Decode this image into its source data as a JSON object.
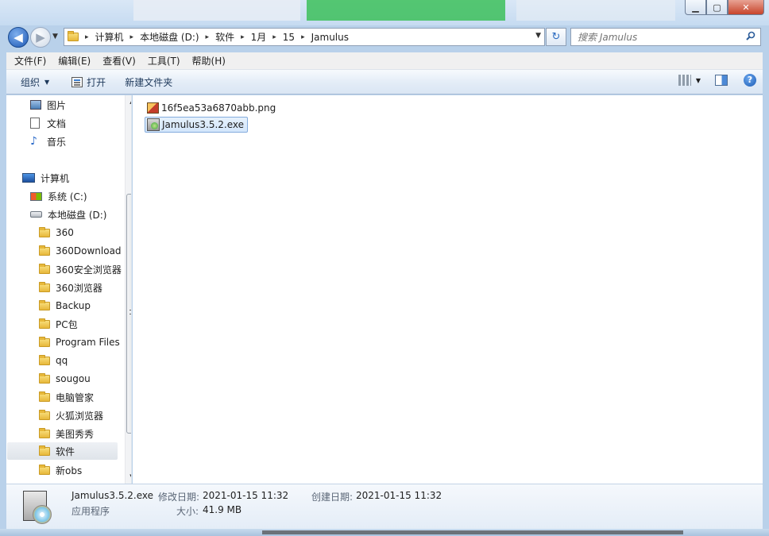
{
  "window": {
    "controls": {
      "minimize": "▁",
      "maximize": "▢",
      "close": "✕"
    }
  },
  "navigation": {
    "back_glyph": "◀",
    "forward_glyph": "▶",
    "history_glyph": "▼"
  },
  "address": {
    "breadcrumbs": [
      "计算机",
      "本地磁盘 (D:)",
      "软件",
      "1月",
      "15",
      "Jamulus"
    ],
    "separator": "▸",
    "dropdown_glyph": "▼",
    "refresh_glyph": "↻"
  },
  "search": {
    "placeholder": "搜索 Jamulus"
  },
  "menubar": {
    "items": [
      "文件(F)",
      "编辑(E)",
      "查看(V)",
      "工具(T)",
      "帮助(H)"
    ]
  },
  "commandbar": {
    "organize": "组织",
    "organize_arrow": "▼",
    "open": "打开",
    "new_folder": "新建文件夹",
    "view_arrow": "▼",
    "help_glyph": "?"
  },
  "nav_pane": {
    "items": [
      {
        "label": "图片",
        "icon": "pictures-icon"
      },
      {
        "label": "文档",
        "icon": "documents-icon"
      },
      {
        "label": "音乐",
        "icon": "music-icon"
      },
      {
        "label": "计算机",
        "icon": "computer-icon"
      },
      {
        "label": "系统 (C:)",
        "icon": "system-drive-icon"
      },
      {
        "label": "本地磁盘 (D:)",
        "icon": "drive-icon"
      },
      {
        "label": "360",
        "icon": "folder-icon"
      },
      {
        "label": "360Download",
        "icon": "folder-icon"
      },
      {
        "label": "360安全浏览器",
        "icon": "folder-icon"
      },
      {
        "label": "360浏览器",
        "icon": "folder-icon"
      },
      {
        "label": "Backup",
        "icon": "folder-icon"
      },
      {
        "label": "PC包",
        "icon": "folder-icon"
      },
      {
        "label": "Program Files",
        "icon": "folder-icon"
      },
      {
        "label": "qq",
        "icon": "folder-icon"
      },
      {
        "label": "sougou",
        "icon": "folder-icon"
      },
      {
        "label": "电脑管家",
        "icon": "folder-icon"
      },
      {
        "label": "火狐浏览器",
        "icon": "folder-icon"
      },
      {
        "label": "美图秀秀",
        "icon": "folder-icon"
      },
      {
        "label": "软件",
        "icon": "folder-icon",
        "selected": true
      },
      {
        "label": "新obs",
        "icon": "folder-icon"
      }
    ],
    "scroll_up": "▲",
    "scroll_down": "▼"
  },
  "files": [
    {
      "name": "16f5ea53a6870abb.png",
      "icon": "png-file-icon",
      "selected": false
    },
    {
      "name": "Jamulus3.5.2.exe",
      "icon": "exe-file-icon",
      "selected": true
    }
  ],
  "details": {
    "filename": "Jamulus3.5.2.exe",
    "type": "应用程序",
    "modified_label": "修改日期:",
    "modified_value": "2021-01-15 11:32",
    "created_label": "创建日期:",
    "created_value": "2021-01-15 11:32",
    "size_label": "大小:",
    "size_value": "41.9 MB"
  }
}
